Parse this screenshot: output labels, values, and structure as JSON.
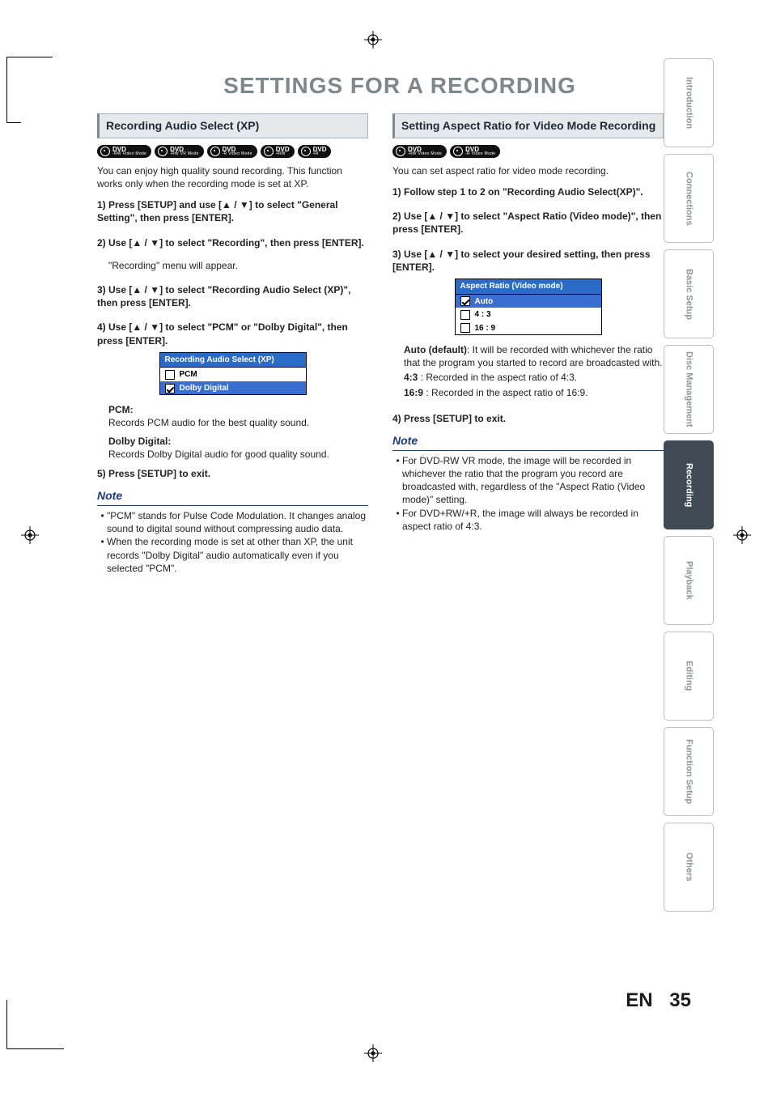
{
  "page": {
    "title": "SETTINGS FOR A RECORDING",
    "lang": "EN",
    "number": "35"
  },
  "tabs": [
    "Introduction",
    "Connections",
    "Basic Setup",
    "Disc Management",
    "Recording",
    "Playback",
    "Editing",
    "Function Setup",
    "Others"
  ],
  "tabs_active_index": 4,
  "left": {
    "heading": "Recording Audio Select (XP)",
    "badges": [
      {
        "top": "DVD",
        "sub": "-RW Video Mode"
      },
      {
        "top": "DVD",
        "sub": "-RW VR Mode"
      },
      {
        "top": "DVD",
        "sub": "-R Video Mode"
      },
      {
        "top": "DVD",
        "sub": "+RW"
      },
      {
        "top": "DVD",
        "sub": "+R"
      }
    ],
    "intro": "You can enjoy high quality sound recording. This function works only when the recording mode is set at XP.",
    "steps": {
      "s1": "1) Press [SETUP] and use [▲ / ▼] to select \"General Setting\", then press [ENTER].",
      "s2": "2) Use [▲ / ▼] to select \"Recording\", then press [ENTER].",
      "s2_after": "\"Recording\" menu will appear.",
      "s3": "3) Use [▲ / ▼] to select \"Recording Audio Select (XP)\", then press [ENTER].",
      "s4": "4) Use [▲ / ▼] to select \"PCM\" or \"Dolby Digital\", then press [ENTER].",
      "s5": "5) Press [SETUP] to exit."
    },
    "menu": {
      "title": "Recording Audio Select (XP)",
      "rows": [
        {
          "label": "PCM",
          "checked": false,
          "selected": false
        },
        {
          "label": "Dolby Digital",
          "checked": true,
          "selected": true
        }
      ]
    },
    "defs": {
      "pcm_t": "PCM:",
      "pcm_b": "Records PCM audio for the best quality sound.",
      "dd_t": "Dolby Digital:",
      "dd_b": "Records Dolby Digital audio for good quality sound."
    },
    "note_head": "Note",
    "notes": [
      "\"PCM\" stands for Pulse Code Modulation. It changes analog sound to digital sound without compressing audio data.",
      "When the recording mode is set at other than XP, the unit records \"Dolby Digital\" audio automatically even if you selected \"PCM\"."
    ]
  },
  "right": {
    "heading": "Setting Aspect Ratio for Video Mode Recording",
    "badges": [
      {
        "top": "DVD",
        "sub": "-RW Video Mode"
      },
      {
        "top": "DVD",
        "sub": "-R Video Mode"
      }
    ],
    "intro": "You can set aspect ratio for video mode recording.",
    "steps": {
      "s1": "1) Follow step 1 to 2 on \"Recording Audio Select(XP)\".",
      "s2": "2) Use [▲ / ▼] to select \"Aspect Ratio (Video mode)\", then press [ENTER].",
      "s3": "3) Use [▲ / ▼] to select your desired setting, then press [ENTER].",
      "s4": "4) Press [SETUP] to exit."
    },
    "menu": {
      "title": "Aspect Ratio (Video mode)",
      "rows": [
        {
          "label": "Auto",
          "checked": true,
          "selected": true
        },
        {
          "label": "4 : 3",
          "checked": false,
          "selected": false
        },
        {
          "label": "16 : 9",
          "checked": false,
          "selected": false
        }
      ]
    },
    "defs": {
      "auto_t": "Auto (default)",
      "auto_b": ": It will be recorded with whichever the ratio that the program you started to record are broadcasted with.",
      "r43_t": "4:3",
      "r43_b": ":    Recorded in the aspect ratio of 4:3.",
      "r169_t": "16:9",
      "r169_b": ":  Recorded in the aspect ratio of 16:9."
    },
    "note_head": "Note",
    "notes": [
      "For DVD-RW VR mode, the image will be recorded in whichever the ratio that the program you record are broadcasted with, regardless of the \"Aspect Ratio (Video mode)\" setting.",
      "For DVD+RW/+R, the image will always be recorded in aspect ratio of 4:3."
    ]
  }
}
